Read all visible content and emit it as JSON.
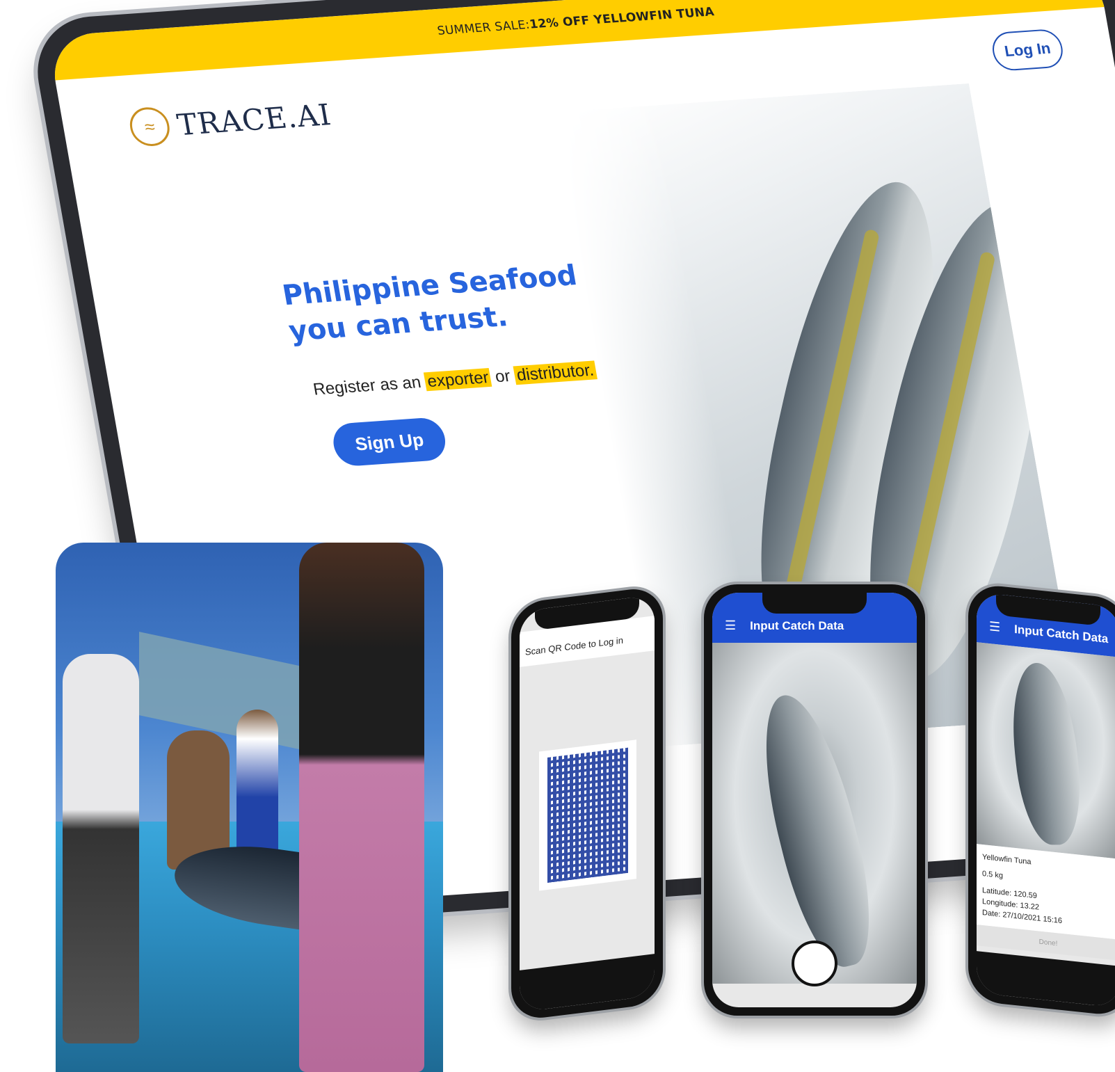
{
  "tablet": {
    "promo_prefix": "SUMMER SALE: ",
    "promo_highlight": "12% OFF YELLOWFIN TUNA",
    "logo_text": "TRACE.AI",
    "login_label": "Log In",
    "hero_line1": "Philippine Seafood",
    "hero_line2": "you can trust.",
    "register_prefix": "Register as an",
    "register_exporter": "exporter",
    "register_or": "or",
    "register_distributor": "distributor.",
    "signup_label": "Sign Up",
    "accent_color": "#2764dd",
    "promo_color": "#ffcd00"
  },
  "phone_login": {
    "title": "Scan QR Code to Log in"
  },
  "phone_camera": {
    "appbar_title": "Input Catch Data",
    "appbar_color": "#1f4fd1"
  },
  "phone_details": {
    "appbar_title": "Input Catch Data",
    "species": "Yellowfin Tuna",
    "weight": "0.5 kg",
    "latitude_label": "Latitude:",
    "latitude_value": "120.59",
    "longitude_label": "Longitude:",
    "longitude_value": "13.22",
    "date_label": "Date:",
    "date_value": "27/10/2021  15:16",
    "done_label": "Done!"
  }
}
